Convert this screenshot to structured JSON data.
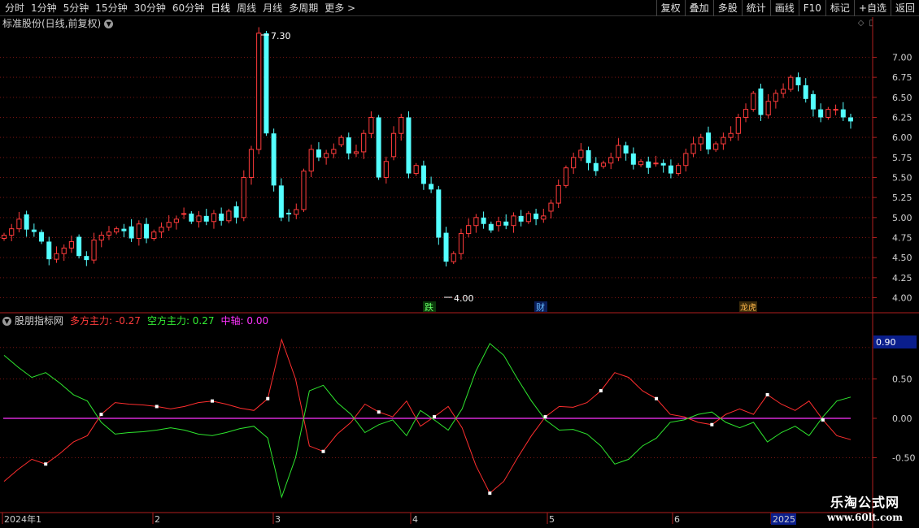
{
  "toolbar": {
    "periods": [
      "分时",
      "1分钟",
      "5分钟",
      "15分钟",
      "30分钟",
      "60分钟",
      "日线",
      "周线",
      "月线",
      "多周期",
      "更多 >"
    ],
    "active_period": "日线",
    "buttons": [
      "复权",
      "叠加",
      "多股",
      "统计",
      "画线",
      "F10",
      "标记",
      "+自选",
      "返回"
    ]
  },
  "main_chart": {
    "title": "标准股份(日线,前复权)",
    "price_axis": [
      "7.00",
      "6.75",
      "6.50",
      "6.25",
      "6.00",
      "5.75",
      "5.50",
      "5.25",
      "5.00",
      "4.75",
      "4.50",
      "4.25",
      "4.00"
    ],
    "high_label": "7.30",
    "low_label": "4.00",
    "markers": [
      "跌",
      "财",
      "龙虎"
    ]
  },
  "indicator": {
    "name": "股朋指标网",
    "duo_label": "多方主力: -0.27",
    "kong_label": "空方主力: 0.27",
    "mid_label": "中轴: 0.00",
    "current_value": "0.90",
    "axis": [
      "0.50",
      "0.00",
      "-0.50"
    ]
  },
  "time_axis": {
    "labels": [
      "2024年1",
      "2",
      "3",
      "4",
      "5",
      "6",
      "2025"
    ]
  },
  "watermark": {
    "line1": "乐淘公式网",
    "line2": "www.60lt.com"
  },
  "colors": {
    "up": "#ff3b3b",
    "down": "#54ffff",
    "duo": "#ff2e2e",
    "kong": "#2ee62e",
    "mid": "#ff33ff",
    "value_box": "#0a1e8c"
  },
  "chart_data": [
    {
      "type": "candlestick",
      "title": "标准股份(日线,前复权)",
      "ylim": [
        4.0,
        7.3
      ],
      "series": [
        {
          "name": "日线",
          "close": [
            4.78,
            4.86,
            4.98,
            4.85,
            4.82,
            4.7,
            4.48,
            4.55,
            4.62,
            4.7,
            4.52,
            4.47,
            4.72,
            4.78,
            4.82,
            4.86,
            4.83,
            4.74,
            4.92,
            4.74,
            4.82,
            4.88,
            4.94,
            4.98,
            5.05,
            4.95,
            5.02,
            4.95,
            5.05,
            4.96,
            5.08,
            5.0,
            5.5,
            5.85,
            7.3,
            6.05,
            5.4,
            5.0,
            5.04,
            5.1,
            5.58,
            5.85,
            5.75,
            5.8,
            5.85,
            6.0,
            5.8,
            5.82,
            6.05,
            6.25,
            5.5,
            5.7,
            6.05,
            6.25,
            5.55,
            5.65,
            5.42,
            5.35,
            4.75,
            4.45,
            4.55,
            4.8,
            4.9,
            5.0,
            4.92,
            4.84,
            4.95,
            4.9,
            5.02,
            4.95,
            5.05,
            4.98,
            5.02,
            5.18,
            5.4,
            5.62,
            5.75,
            5.84,
            5.68,
            5.58,
            5.68,
            5.75,
            5.9,
            5.8,
            5.66,
            5.7,
            5.62,
            5.68,
            5.65,
            5.55,
            5.65,
            5.8,
            5.92,
            6.0,
            5.85,
            5.92,
            6.0,
            6.05,
            6.25,
            6.35,
            6.55,
            6.28,
            6.45,
            6.55,
            6.6,
            6.75,
            6.65,
            6.48,
            6.35,
            6.25,
            6.35,
            6.35,
            6.25,
            6.2
          ]
        }
      ],
      "high_label": 7.3,
      "low_label": 4.0
    },
    {
      "type": "line",
      "title": "股朋指标网",
      "x": [
        "2024年1",
        "2",
        "3",
        "4",
        "5",
        "6",
        "2025"
      ],
      "ylim": [
        -1.0,
        1.0
      ],
      "series": [
        {
          "name": "多方主力",
          "values": [
            -0.8,
            -0.65,
            -0.52,
            -0.58,
            -0.45,
            -0.3,
            -0.22,
            0.05,
            0.2,
            0.18,
            0.17,
            0.15,
            0.12,
            0.15,
            0.2,
            0.22,
            0.18,
            0.13,
            0.1,
            0.25,
            1.0,
            0.5,
            -0.35,
            -0.42,
            -0.2,
            -0.05,
            0.18,
            0.08,
            0.02,
            0.22,
            -0.1,
            0.02,
            0.15,
            -0.12,
            -0.6,
            -0.95,
            -0.8,
            -0.5,
            -0.22,
            0.02,
            0.15,
            0.14,
            0.2,
            0.35,
            0.58,
            0.52,
            0.35,
            0.25,
            0.05,
            0.02,
            -0.05,
            -0.08,
            0.05,
            0.12,
            0.05,
            0.3,
            0.18,
            0.1,
            0.22,
            -0.02,
            -0.22,
            -0.27
          ]
        },
        {
          "name": "空方主力",
          "values": [
            0.8,
            0.65,
            0.52,
            0.58,
            0.45,
            0.3,
            0.22,
            -0.05,
            -0.2,
            -0.18,
            -0.17,
            -0.15,
            -0.12,
            -0.15,
            -0.2,
            -0.22,
            -0.18,
            -0.13,
            -0.1,
            -0.25,
            -1.0,
            -0.5,
            0.35,
            0.42,
            0.2,
            0.05,
            -0.18,
            -0.08,
            -0.02,
            -0.22,
            0.1,
            -0.02,
            -0.15,
            0.12,
            0.6,
            0.95,
            0.8,
            0.5,
            0.22,
            -0.02,
            -0.15,
            -0.14,
            -0.2,
            -0.35,
            -0.58,
            -0.52,
            -0.35,
            -0.25,
            -0.05,
            -0.02,
            0.05,
            0.08,
            -0.05,
            -0.12,
            -0.05,
            -0.3,
            -0.18,
            -0.1,
            -0.22,
            0.02,
            0.22,
            0.27
          ]
        },
        {
          "name": "中轴",
          "values": [
            0.0,
            0.0
          ]
        }
      ]
    }
  ]
}
